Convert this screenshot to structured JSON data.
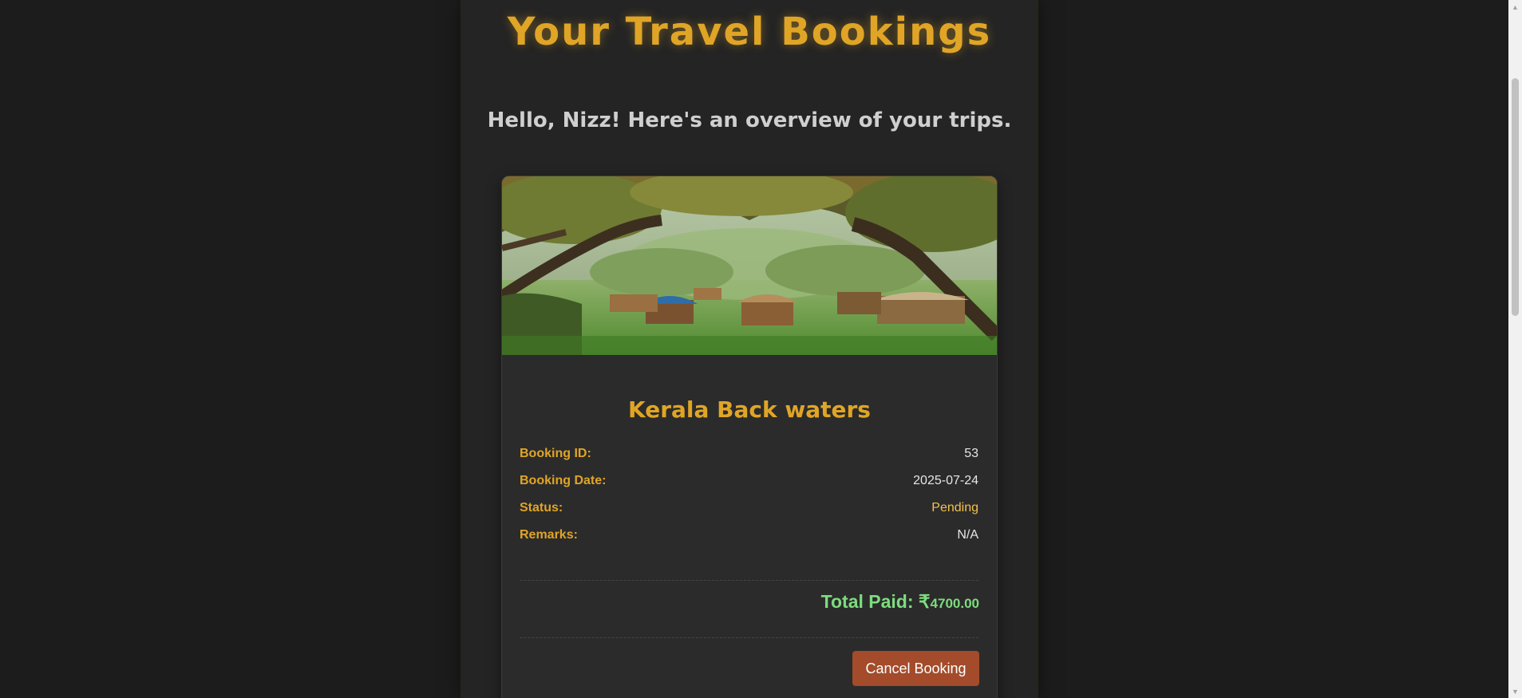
{
  "header": {
    "title": "Your Travel Bookings",
    "greeting": "Hello, Nizz! Here's an overview of your trips."
  },
  "booking": {
    "image_alt": "Kerala backwaters houseboats under trees",
    "destination": "Kerala Back waters",
    "details": [
      {
        "label": "Booking ID:",
        "value": "53"
      },
      {
        "label": "Booking Date:",
        "value": "2025-07-24"
      },
      {
        "label": "Status:",
        "value": "Pending"
      },
      {
        "label": "Remarks:",
        "value": "N/A"
      }
    ],
    "total_label": "Total Paid: ₹",
    "total_amount": "4700.00",
    "cancel_label": "Cancel Booking"
  },
  "colors": {
    "accent": "#e0a526",
    "total": "#7ddc7e",
    "cancel": "#a34b2a",
    "status_pending": "#f2c14e"
  },
  "icons": {
    "scroll_up": "triangle-up-icon",
    "scroll_down": "triangle-down-icon"
  }
}
